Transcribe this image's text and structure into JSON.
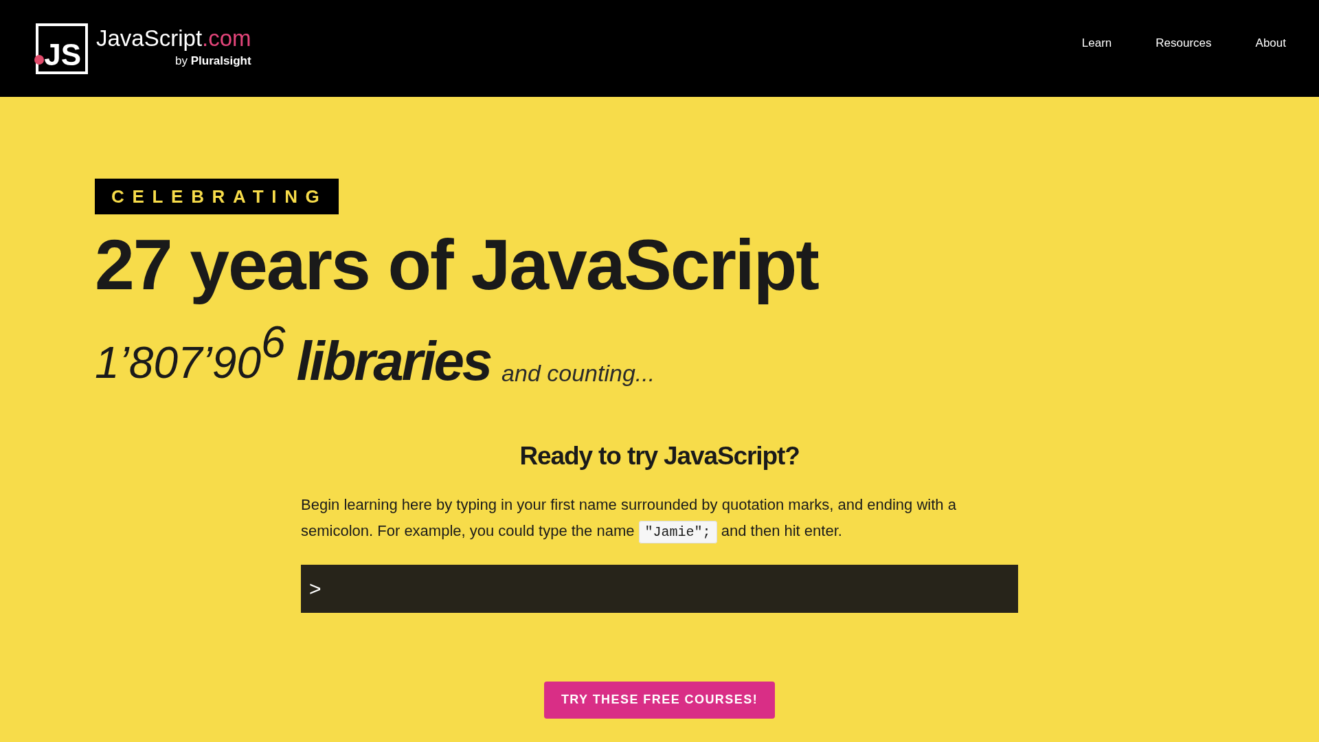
{
  "header": {
    "logo_mark": "JS",
    "logo_name": "JavaScript",
    "logo_tld": ".com",
    "logo_by": "by",
    "logo_brand": "Pluralsight",
    "nav": [
      {
        "label": "Learn"
      },
      {
        "label": "Resources"
      },
      {
        "label": "About"
      }
    ]
  },
  "hero": {
    "badge": "CELEBRATING",
    "title": "27 years of JavaScript",
    "counter": "1’807’90",
    "counter_last": "6",
    "counter_noun": "libraries",
    "counter_suffix": "and counting..."
  },
  "try": {
    "title": "Ready to try JavaScript?",
    "text_before": "Begin learning here by typing in your first name surrounded by quotation marks, and ending with a semicolon. For example, you could type the name",
    "example": "\"Jamie\";",
    "text_after": "and then hit enter.",
    "prompt": ">"
  },
  "cta": {
    "label": "TRY THESE FREE COURSES!"
  }
}
